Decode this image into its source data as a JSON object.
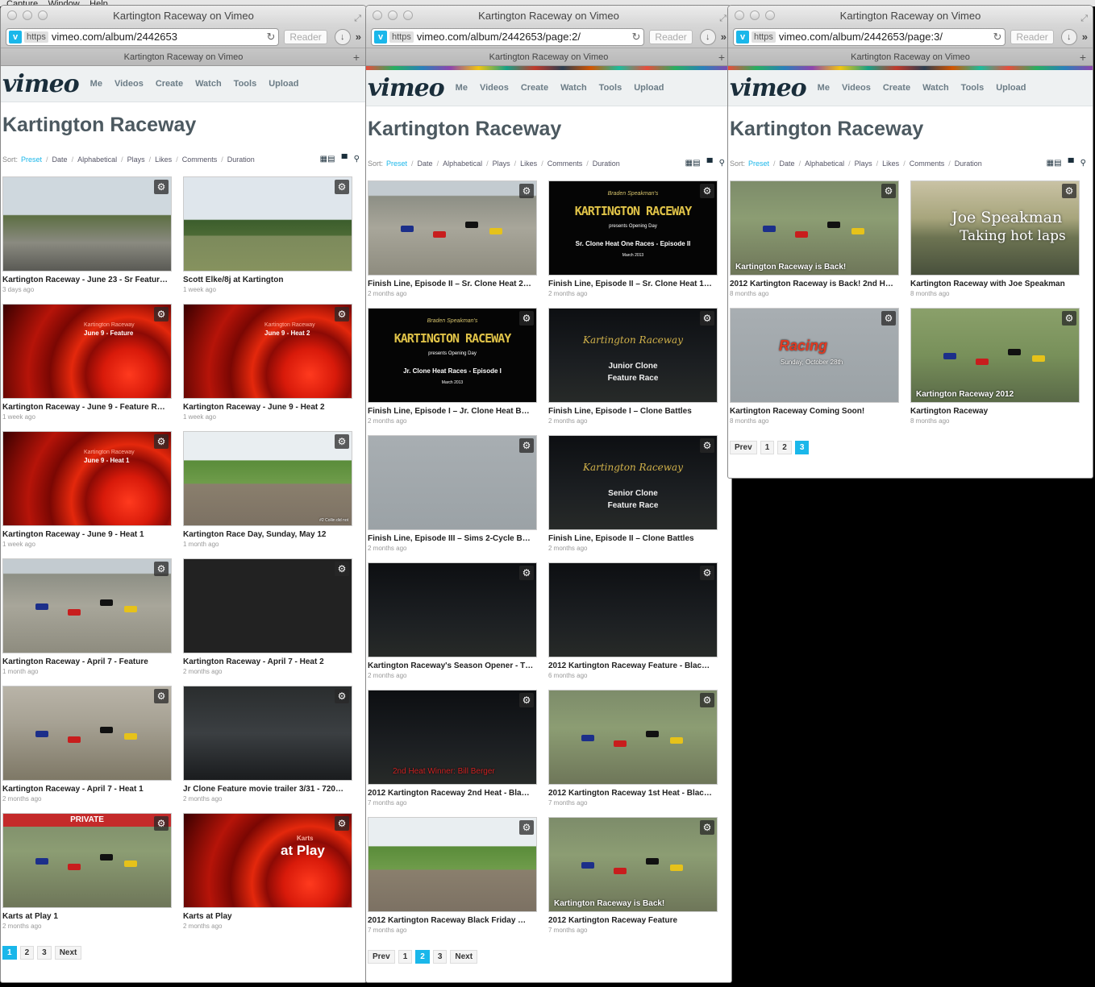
{
  "menubar": {
    "items": [
      "Capture",
      "Window",
      "Help"
    ]
  },
  "windows": [
    {
      "title": "Kartington Raceway on Vimeo",
      "url_scheme": "https",
      "url": "vimeo.com/album/2442653",
      "reader": "Reader",
      "tab": "Kartington Raceway on Vimeo",
      "nav": [
        "Me",
        "Videos",
        "Create",
        "Watch",
        "Tools",
        "Upload"
      ],
      "page_title": "Kartington Raceway",
      "sort_label": "Sort:",
      "sort_options": [
        "Preset",
        "Date",
        "Alphabetical",
        "Plays",
        "Likes",
        "Comments",
        "Duration"
      ],
      "videos": [
        {
          "title": "Kartington Raceway - June 23 - Sr Featur…",
          "ago": "3 days ago"
        },
        {
          "title": "Scott Elke/8j at Kartington",
          "ago": "1 week ago"
        },
        {
          "title": "Kartington Raceway - June 9 - Feature R…",
          "ago": "1 week ago",
          "caption": "Kartington Raceway",
          "caption2": "June 9 - Feature"
        },
        {
          "title": "Kartington Raceway - June 9 - Heat 2",
          "ago": "1 week ago",
          "caption": "Kartington Raceway",
          "caption2": "June 9 - Heat 2"
        },
        {
          "title": "Kartington Raceway - June 9 - Heat 1",
          "ago": "1 week ago",
          "caption": "Kartington Raceway",
          "caption2": "June 9 - Heat 1"
        },
        {
          "title": "Kartington Race Day, Sunday, May 12",
          "ago": "1 month ago",
          "caption": "#2 Collin did not"
        },
        {
          "title": "Kartington Raceway - April 7 - Feature",
          "ago": "1 month ago"
        },
        {
          "title": "Kartington Raceway - April 7 - Heat 2",
          "ago": "2 months ago"
        },
        {
          "title": "Kartington Raceway - April 7 - Heat 1",
          "ago": "2 months ago"
        },
        {
          "title": "Jr Clone Feature movie trailer 3/31 - 720…",
          "ago": "2 months ago"
        },
        {
          "title": "Karts at Play 1",
          "ago": "2 months ago",
          "badge": "PRIVATE"
        },
        {
          "title": "Karts at Play",
          "ago": "2 months ago",
          "caption": "Karts",
          "caption2": "at Play"
        }
      ],
      "pager": [
        "1",
        "2",
        "3",
        "Next"
      ]
    },
    {
      "title": "Kartington Raceway on Vimeo",
      "url_scheme": "https",
      "url": "vimeo.com/album/2442653/page:2/",
      "reader": "Reader",
      "tab": "Kartington Raceway on Vimeo",
      "nav": [
        "Me",
        "Videos",
        "Create",
        "Watch",
        "Tools",
        "Upload"
      ],
      "page_title": "Kartington Raceway",
      "sort_label": "Sort:",
      "sort_options": [
        "Preset",
        "Date",
        "Alphabetical",
        "Plays",
        "Likes",
        "Comments",
        "Duration"
      ],
      "videos": [
        {
          "title": "Finish Line, Episode II – Sr. Clone Heat 2…",
          "ago": "2 months ago"
        },
        {
          "title": "Finish Line, Episode II – Sr. Clone Heat 1…",
          "ago": "2 months ago",
          "caption0": "Braden Speakman's",
          "caption": "KARTINGTON RACEWAY",
          "caption1": "presents Opening Day",
          "caption2": "Sr. Clone Heat One Races - Episode II",
          "caption3": "March 2013"
        },
        {
          "title": "Finish Line, Episode I – Jr. Clone Heat B…",
          "ago": "2 months ago",
          "caption0": "Braden Speakman's",
          "caption": "KARTINGTON RACEWAY",
          "caption1": "presents Opening Day",
          "caption2": "Jr. Clone Heat Races - Episode I",
          "caption3": "March 2013"
        },
        {
          "title": "Finish Line, Episode I – Clone Battles",
          "ago": "2 months ago",
          "caption": "Kartington Raceway",
          "caption2": "Junior Clone Feature Race"
        },
        {
          "title": "Finish Line, Episode III – Sims 2-Cycle B…",
          "ago": "2 months ago"
        },
        {
          "title": "Finish Line, Episode II – Clone Battles",
          "ago": "2 months ago",
          "caption": "Kartington Raceway",
          "caption2": "Senior Clone Feature Race"
        },
        {
          "title": "Kartington Raceway's Season Opener - T…",
          "ago": "2 months ago"
        },
        {
          "title": "2012 Kartington Raceway Feature - Blac…",
          "ago": "6 months ago"
        },
        {
          "title": "2012 Kartington Raceway 2nd Heat - Bla…",
          "ago": "7 months ago",
          "caption": "2nd Heat Winner: Bill Berger"
        },
        {
          "title": "2012 Kartington Raceway 1st Heat - Blac…",
          "ago": "7 months ago"
        },
        {
          "title": "2012 Kartington Raceway Black Friday …",
          "ago": "7 months ago"
        },
        {
          "title": "2012 Kartington Raceway Feature",
          "ago": "7 months ago",
          "caption": "Kartington Raceway is Back!"
        }
      ],
      "pager": [
        "Prev",
        "1",
        "2",
        "3",
        "Next"
      ]
    },
    {
      "title": "Kartington Raceway on Vimeo",
      "url_scheme": "https",
      "url": "vimeo.com/album/2442653/page:3/",
      "reader": "Reader",
      "tab": "Kartington Raceway on Vimeo",
      "nav": [
        "Me",
        "Videos",
        "Create",
        "Watch",
        "Tools",
        "Upload"
      ],
      "page_title": "Kartington Raceway",
      "sort_label": "Sort:",
      "sort_options": [
        "Preset",
        "Date",
        "Alphabetical",
        "Plays",
        "Likes",
        "Comments",
        "Duration"
      ],
      "videos": [
        {
          "title": "2012 Kartington Raceway is Back! 2nd H…",
          "ago": "8 months ago",
          "caption": "Kartington Raceway is Back!"
        },
        {
          "title": "Kartington Raceway with Joe Speakman",
          "ago": "8 months ago",
          "caption": "Joe Speakman",
          "caption2": "Taking hot laps"
        },
        {
          "title": "Kartington Raceway Coming Soon!",
          "ago": "8 months ago",
          "caption": "Racing",
          "caption2": "Sunday, October 28th"
        },
        {
          "title": "Kartington Raceway",
          "ago": "8 months ago",
          "caption": "Kartington Raceway 2012"
        }
      ],
      "pager": [
        "Prev",
        "1",
        "2",
        "3"
      ]
    }
  ],
  "colors": {
    "accent": "#1ab7ea",
    "brand": "#1a2e3b",
    "title": "#4c5960"
  }
}
